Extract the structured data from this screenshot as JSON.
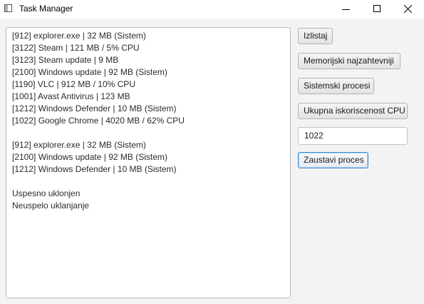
{
  "window": {
    "title": "Task Manager"
  },
  "output": {
    "group1": [
      "[912] explorer.exe | 32 MB (Sistem)",
      "[3122] Steam | 121 MB / 5% CPU",
      "[3123] Steam update | 9 MB",
      "[2100] Windows update | 92 MB (Sistem)",
      "[1190] VLC | 912 MB / 10% CPU",
      "[1001] Avast Antivirus | 123 MB",
      "[1212] Windows Defender | 10 MB (Sistem)",
      "[1022] Google Chrome | 4020 MB / 62% CPU"
    ],
    "group2": [
      "[912] explorer.exe | 32 MB (Sistem)",
      "[2100] Windows update | 92 MB (Sistem)",
      "[1212] Windows Defender | 10 MB (Sistem)"
    ],
    "group3": [
      "Uspesno uklonjen",
      "Neuspelo uklanjanje"
    ]
  },
  "controls": {
    "list_label": "Izlistaj",
    "memory_label": "Memorijski najzahtevniji",
    "system_label": "Sistemski procesi",
    "cpu_label": "Ukupna iskoriscenost CPU",
    "pid_value": "1022",
    "stop_label": "Zaustavi proces"
  },
  "colors": {
    "focus_border": "#3d90d6",
    "background": "#f3f3f3"
  }
}
